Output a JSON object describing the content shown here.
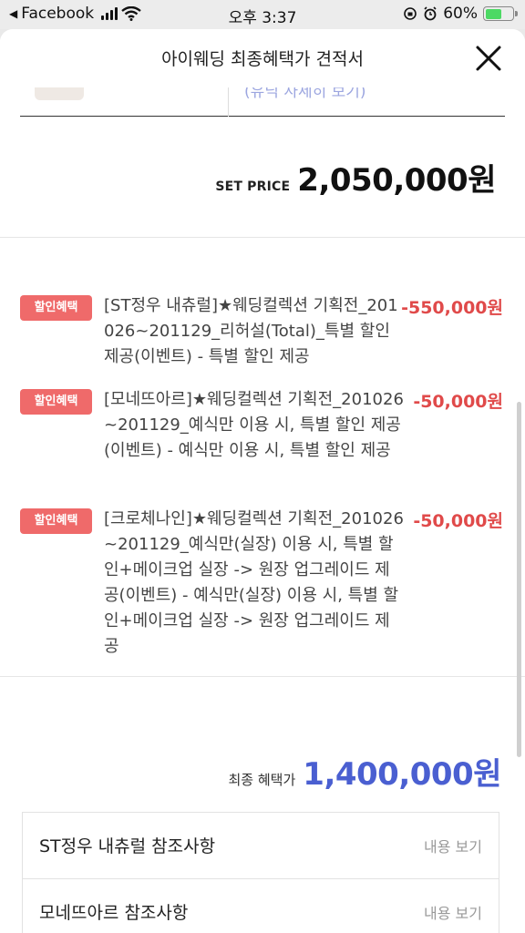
{
  "status_bar": {
    "back_app": "Facebook",
    "time": "오후 3:37",
    "battery_percent": "60%",
    "battery_level": 0.6,
    "battery_color": "#4cd964"
  },
  "sheet": {
    "title": "아이웨딩 최종혜택가 견적서",
    "close_icon": "close-icon"
  },
  "previous_item": {
    "link_text": "(유닉 사세히 보기)"
  },
  "set_price": {
    "label": "SET PRICE",
    "value": "2,050,000원"
  },
  "benefits": [
    {
      "badge": "할인혜택",
      "text": "[ST정우 내츄럴]★웨딩컬렉션 기획전_201026~201129_리허설(Total)_특별 할인 제공(이벤트) - 특별 할인 제공",
      "amount": "-550,000원"
    },
    {
      "badge": "할인혜택",
      "text": "[모네뜨아르]★웨딩컬렉션 기획전_201026~201129_예식만 이용 시, 특별 할인 제공(이벤트) - 예식만 이용 시, 특별 할인 제공",
      "amount": "-50,000원"
    },
    {
      "badge": "할인혜택",
      "text": "[크로체나인]★웨딩컬렉션 기획전_201026~201129_예식만(실장) 이용 시, 특별 할인+메이크업 실장 -> 원장 업그레이드 제공(이벤트) - 예식만(실장) 이용 시, 특별 할인+메이크업 실장 -> 원장 업그레이드 제공",
      "amount": "-50,000원"
    }
  ],
  "final_price": {
    "label": "최종 혜택가",
    "value": "1,400,000원"
  },
  "references": [
    {
      "title": "ST정우 내츄럴 참조사항",
      "more": "내용 보기"
    },
    {
      "title": "모네뜨아르 참조사항",
      "more": "내용 보기"
    }
  ],
  "colors": {
    "badge": "#ef6a6a",
    "discount": "#e04a4a",
    "final_price": "#4a5fd1"
  }
}
